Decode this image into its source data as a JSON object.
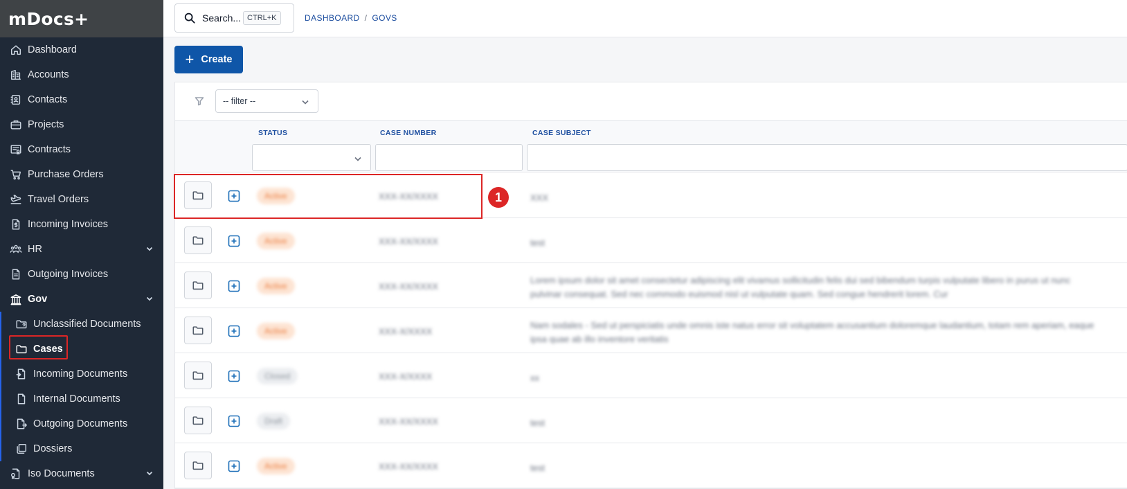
{
  "app": {
    "logo": "mDocs+"
  },
  "sidebar": {
    "items": [
      {
        "label": "Dashboard"
      },
      {
        "label": "Accounts"
      },
      {
        "label": "Contacts"
      },
      {
        "label": "Projects"
      },
      {
        "label": "Contracts"
      },
      {
        "label": "Purchase Orders"
      },
      {
        "label": "Travel Orders"
      },
      {
        "label": "Incoming Invoices"
      },
      {
        "label": "HR"
      },
      {
        "label": "Outgoing Invoices"
      },
      {
        "label": "Gov"
      }
    ],
    "gov_items": [
      {
        "label": "Unclassified Documents"
      },
      {
        "label": "Cases"
      },
      {
        "label": "Incoming Documents"
      },
      {
        "label": "Internal Documents"
      },
      {
        "label": "Outgoing Documents"
      },
      {
        "label": "Dossiers"
      }
    ],
    "last_item": {
      "label": "Iso Documents"
    }
  },
  "topbar": {
    "search_label": "Search...",
    "search_shortcut": "CTRL+K",
    "breadcrumb": [
      "DASHBOARD",
      "GOVS"
    ]
  },
  "toolbar": {
    "create_label": "Create"
  },
  "filter": {
    "placeholder": "-- filter --"
  },
  "table": {
    "columns": [
      "STATUS",
      "CASE NUMBER",
      "CASE SUBJECT"
    ],
    "rows": [
      {
        "status": "Active",
        "case_number": "XXX-XX/XXXX",
        "subject": "XXX"
      },
      {
        "status": "Active",
        "case_number": "XXX-XX/XXXX",
        "subject": "test"
      },
      {
        "status": "Active",
        "case_number": "XXX-XX/XXXX",
        "subject": "Lorem ipsum dolor sit amet consectetur adipiscing elit vivamus sollicitudin felis dui sed bibendum turpis vulputate libero in purus ut nunc pulvinar consequat. Sed nec commodo euismod nisl ut vulputate quam. Sed congue hendrerit lorem. Cur"
      },
      {
        "status": "Active",
        "case_number": "XXX-X/XXXX",
        "subject": "Nam sodales - Sed ut perspiciatis unde omnis iste natus error sit voluptatem accusantium doloremque laudantium, totam rem aperiam, eaque ipsa quae ab illo inventore veritatis"
      },
      {
        "status": "Closed",
        "case_number": "XXX-X/XXXX",
        "subject": "xx"
      },
      {
        "status": "Draft",
        "case_number": "XXX-XX/XXXX",
        "subject": "test"
      },
      {
        "status": "Active",
        "case_number": "XXX-XX/XXXX",
        "subject": "test"
      }
    ]
  },
  "annotation": {
    "marker": "1"
  },
  "colors": {
    "sidebar_bg": "#1f2937",
    "logo_bg": "#3f4346",
    "accent": "#0f56a8",
    "highlight": "#dc2626",
    "status_orange_bg": "#fde4d3",
    "status_orange_text": "#ea7a3b",
    "status_gray_bg": "#eceef1"
  }
}
